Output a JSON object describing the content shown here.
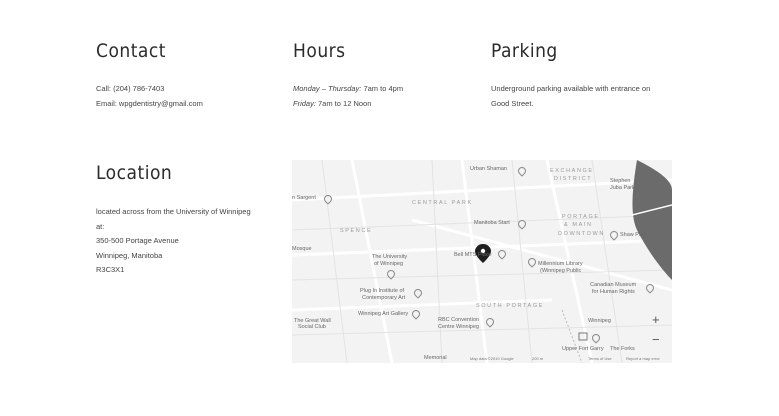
{
  "contact": {
    "heading": "Contact",
    "phone": "Call: (204) 786-7403",
    "email": "Email: wpgdentistry@gmail.com"
  },
  "hours": {
    "heading": "Hours",
    "line1_days": "Monday – Thursday:",
    "line1_time": " 7am to 4pm",
    "line2_days": "Friday:",
    "line2_time": " 7am to 12 Noon"
  },
  "parking": {
    "heading": "Parking",
    "line1": "Underground parking available with entrance on",
    "line2": "Good Street."
  },
  "location": {
    "heading": "Location",
    "line1": "located across from the University of Winnipeg",
    "line2": "at:",
    "line3": "350-500 Portage Avenue",
    "line4": "Winnipeg, Manitoba",
    "line5": "R3C3X1"
  },
  "map": {
    "labels": {
      "urban_shaman": "Urban Shaman",
      "exchange": "EXCHANGE",
      "district": "DISTRICT",
      "stephen_juba": "Stephen",
      "stephen_juba2": "Juba Park",
      "sargent": "n Sargent",
      "central_park": "CENTRAL PARK",
      "manitoba_start": "Manitoba Start",
      "portage_main": "PORTAGE",
      "portage_main2": "& MAIN",
      "downtown": "DOWNTOWN",
      "spence": "SPENCE",
      "shaw_park": "Shaw Park",
      "mosque": "Mosque",
      "university": "The University",
      "university2": "of Winnipeg",
      "bell_mts": "Bell MTS Place",
      "millennium": "Millennium Library",
      "millennium2": "(Winnipeg Public",
      "plug_in": "Plug In Institute of",
      "plug_in2": "Contemporary Art",
      "canadian_museum": "Canadian Museum",
      "canadian_museum2": "for Human Rights",
      "south_portage": "SOUTH PORTAGE",
      "great_wall": "The Great Wall",
      "great_wall2": "Social Club",
      "art_gallery": "Winnipeg Art Gallery",
      "rbc": "RBC Convention",
      "rbc2": "Centre Winnipeg",
      "winnipeg": "Winnipeg",
      "upper_fort": "Upper Fort Garry",
      "the_forks": "The Forks",
      "memorial": "Memorial"
    },
    "zoom_in": "+",
    "zoom_out": "−",
    "attribution": {
      "data": "Map data ©2019 Google",
      "scale": "200 m",
      "terms": "Terms of Use",
      "report": "Report a map error"
    }
  }
}
